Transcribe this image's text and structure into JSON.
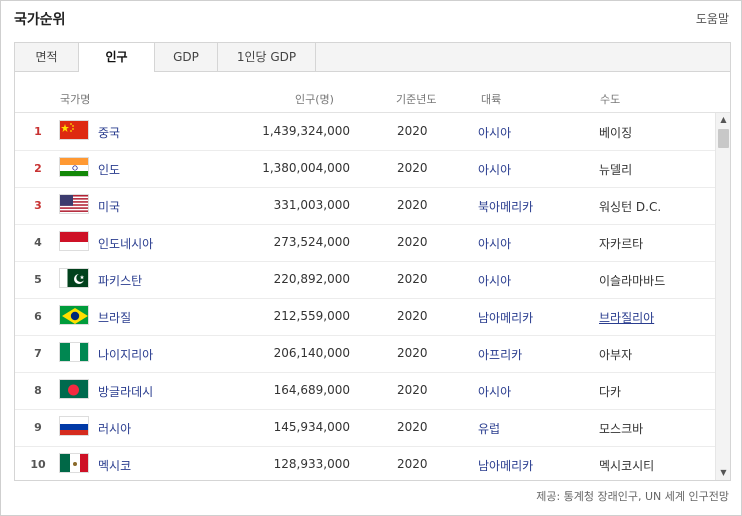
{
  "header": {
    "title": "국가순위",
    "help": "도움말"
  },
  "tabs": [
    {
      "label": "면적",
      "active": false
    },
    {
      "label": "인구",
      "active": true
    },
    {
      "label": "GDP",
      "active": false
    },
    {
      "label": "1인당 GDP",
      "active": false
    }
  ],
  "columns": {
    "country": "국가명",
    "population": "인구(명)",
    "year": "기준년도",
    "continent": "대륙",
    "capital": "수도"
  },
  "rows": [
    {
      "rank": "1",
      "flag": "china-flag",
      "name": "중국",
      "population": "1,439,324,000",
      "year": "2020",
      "continent": "아시아",
      "capital": "베이징"
    },
    {
      "rank": "2",
      "flag": "india-flag",
      "name": "인도",
      "population": "1,380,004,000",
      "year": "2020",
      "continent": "아시아",
      "capital": "뉴델리"
    },
    {
      "rank": "3",
      "flag": "usa-flag",
      "name": "미국",
      "population": "331,003,000",
      "year": "2020",
      "continent": "북아메리카",
      "capital": "워싱턴 D.C."
    },
    {
      "rank": "4",
      "flag": "indonesia-flag",
      "name": "인도네시아",
      "population": "273,524,000",
      "year": "2020",
      "continent": "아시아",
      "capital": "자카르타"
    },
    {
      "rank": "5",
      "flag": "pakistan-flag",
      "name": "파키스탄",
      "population": "220,892,000",
      "year": "2020",
      "continent": "아시아",
      "capital": "이슬라마바드"
    },
    {
      "rank": "6",
      "flag": "brazil-flag",
      "name": "브라질",
      "population": "212,559,000",
      "year": "2020",
      "continent": "남아메리카",
      "capital": "브라질리아"
    },
    {
      "rank": "7",
      "flag": "nigeria-flag",
      "name": "나이지리아",
      "population": "206,140,000",
      "year": "2020",
      "continent": "아프리카",
      "capital": "아부자"
    },
    {
      "rank": "8",
      "flag": "bangladesh-flag",
      "name": "방글라데시",
      "population": "164,689,000",
      "year": "2020",
      "continent": "아시아",
      "capital": "다카"
    },
    {
      "rank": "9",
      "flag": "russia-flag",
      "name": "러시아",
      "population": "145,934,000",
      "year": "2020",
      "continent": "유럽",
      "capital": "모스크바"
    },
    {
      "rank": "10",
      "flag": "mexico-flag",
      "name": "멕시코",
      "population": "128,933,000",
      "year": "2020",
      "continent": "남아메리카",
      "capital": "멕시코시티"
    }
  ],
  "source": "제공: 통계청 장래인구, UN 세계 인구전망",
  "colors": {
    "rank_top": "#c83232",
    "link": "#2a3d8f"
  }
}
